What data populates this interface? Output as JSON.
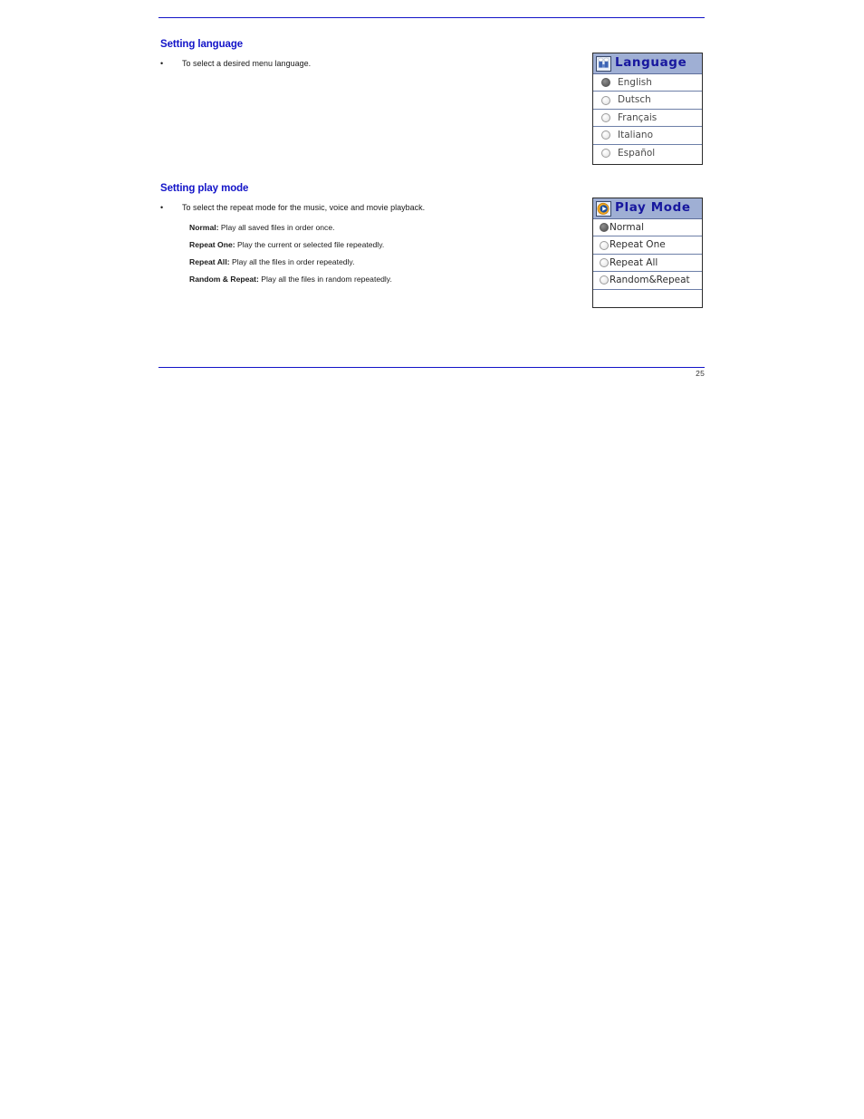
{
  "document": {
    "page_number": "25",
    "accent_color": "#1314c8",
    "heading_color": "#1314c8",
    "titlebar_color": "#9fafd4",
    "titlebar_text_color": "#17179e"
  },
  "sections": [
    {
      "heading": "Setting language",
      "bullet": "To select a desired menu language.",
      "bullet_mark": "•"
    },
    {
      "heading": "Setting play mode",
      "bullet": "To select the repeat mode for the music, voice and movie playback.",
      "bullet_mark": "•",
      "modes": [
        {
          "term": "Normal:",
          "definition": " Play all saved files in order once."
        },
        {
          "term": "Repeat One:",
          "definition": " Play the current or selected file repeatedly."
        },
        {
          "term": "Repeat All:",
          "definition": " Play all the files in order repeatedly."
        },
        {
          "term": "Random & Repeat:",
          "definition": " Play all the files in random repeatedly."
        }
      ]
    }
  ],
  "language_widget": {
    "icon": "language-people-icon",
    "title": "Language",
    "options": [
      {
        "label": "English",
        "selected": true
      },
      {
        "label": "Dutsch",
        "selected": false
      },
      {
        "label": "Français",
        "selected": false
      },
      {
        "label": "Italiano",
        "selected": false
      },
      {
        "label": "Español",
        "selected": false
      }
    ]
  },
  "playmode_widget": {
    "icon": "play-circle-icon",
    "title": "Play Mode",
    "options": [
      {
        "label": "Normal",
        "selected": true
      },
      {
        "label": "Repeat One",
        "selected": false
      },
      {
        "label": "Repeat All",
        "selected": false
      },
      {
        "label": "Random&Repeat",
        "selected": false
      }
    ]
  }
}
